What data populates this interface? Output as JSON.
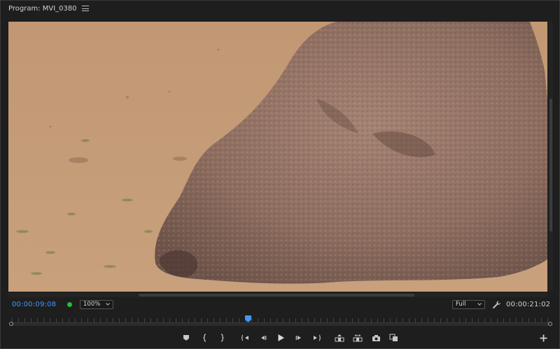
{
  "panel": {
    "title": "Program: MVI_0380",
    "menu_icon": "hamburger-menu-icon"
  },
  "info": {
    "current_timecode": "00:00:09:08",
    "zoom_level": "100%",
    "resolution": "Full",
    "duration_timecode": "00:00:21:02",
    "status_color": "#1fbf3a",
    "timecode_color": "#3f97ff"
  },
  "scrubber": {
    "playhead_fraction": 0.44
  },
  "transport": {
    "buttons": [
      "add-marker-icon",
      "mark-in-icon",
      "mark-out-icon",
      "go-to-in-icon",
      "step-back-icon",
      "play-icon",
      "step-forward-icon",
      "go-to-out-icon",
      "lift-icon",
      "extract-icon",
      "export-frame-icon",
      "comparison-view-icon",
      "button-editor-icon"
    ]
  },
  "colors": {
    "accent": "#3f97ff",
    "sand": "#c49a72",
    "rock": "#9a7a6a"
  }
}
